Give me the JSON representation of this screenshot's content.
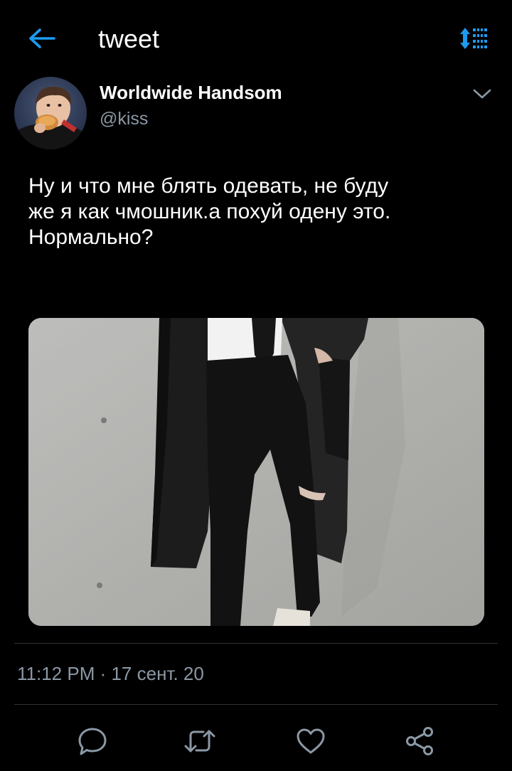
{
  "header": {
    "title": "tweet",
    "back_icon": "arrow-left-icon",
    "sort_icon": "sort-icon",
    "accent_color": "#1d9bf0"
  },
  "tweet": {
    "author_name": "Worldwide Handsom",
    "author_handle": "@kiss",
    "text": "Ну и что мне блять одевать, не буду\nже я как чмошник.а похуй одену это.\nНормально?",
    "time": "11:12 PM",
    "separator": " · ",
    "date": "17 сент. 20"
  },
  "actions": [
    {
      "name": "reply",
      "icon": "reply-icon"
    },
    {
      "name": "retweet",
      "icon": "retweet-icon"
    },
    {
      "name": "like",
      "icon": "heart-icon"
    },
    {
      "name": "share",
      "icon": "share-icon"
    }
  ],
  "colors": {
    "background": "#000000",
    "text": "#ffffff",
    "secondary_text": "#8b98a5",
    "divider": "#2f3336",
    "icon": "#8b98a5"
  }
}
